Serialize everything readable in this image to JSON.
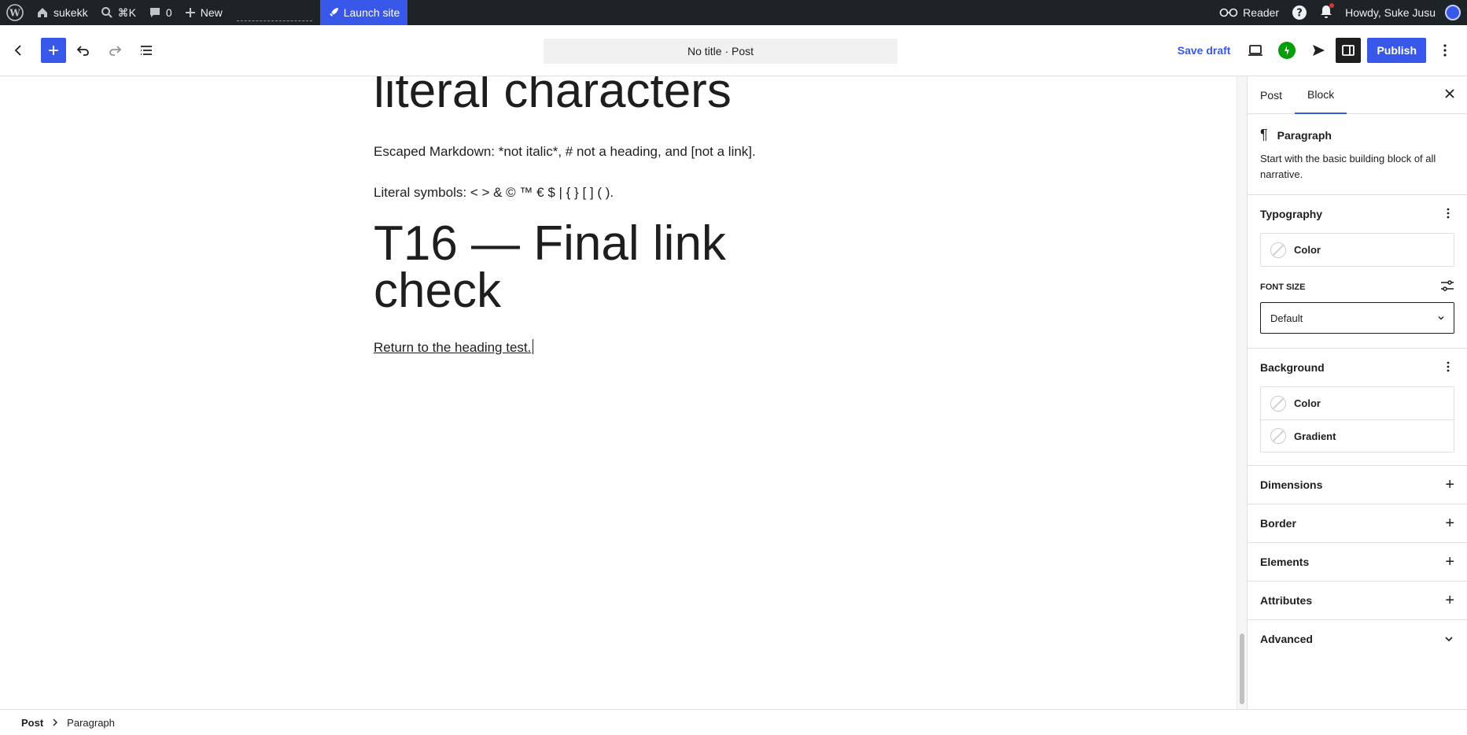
{
  "adminbar": {
    "site_name": "sukekk",
    "search_shortcut": "⌘K",
    "comments_count": "0",
    "new_label": "New",
    "launch_label": "Launch site",
    "reader_label": "Reader",
    "howdy_label": "Howdy, Suke Jusu"
  },
  "header": {
    "doc_title": "No title · Post",
    "save_draft_label": "Save draft",
    "publish_label": "Publish"
  },
  "content": {
    "heading_top": "literal characters",
    "para1": "Escaped Markdown: *not italic*, # not a heading, and [not a link].",
    "para2": "Literal symbols: < > & © ™ € $ | { } [ ] ( ).",
    "heading2": "T16 — Final link check",
    "para3": "Return to the heading test."
  },
  "sidebar": {
    "tab_post": "Post",
    "tab_block": "Block",
    "block_name": "Paragraph",
    "block_desc": "Start with the basic building block of all narrative.",
    "typography": "Typography",
    "typo_color": "Color",
    "font_size_label": "Font size",
    "font_size_value": "Default",
    "background": "Background",
    "bg_color": "Color",
    "bg_gradient": "Gradient",
    "dimensions": "Dimensions",
    "border": "Border",
    "elements": "Elements",
    "attributes": "Attributes",
    "advanced": "Advanced"
  },
  "footer": {
    "crumb_post": "Post",
    "crumb_paragraph": "Paragraph"
  },
  "colors": {
    "accent": "#3858e9",
    "adminbar_bg": "#1d2327"
  }
}
